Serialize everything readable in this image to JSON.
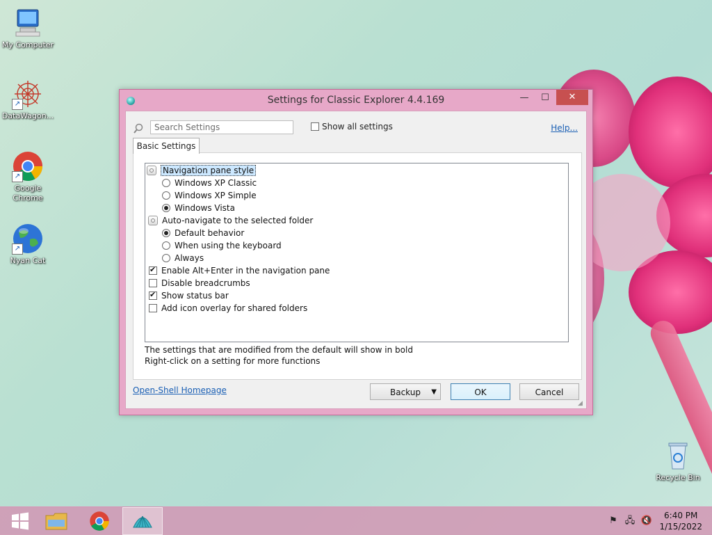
{
  "desktop": {
    "icons": [
      {
        "label": "My Computer",
        "icon": "computer-icon"
      },
      {
        "label": "DataWagon...",
        "icon": "datawagon-icon"
      },
      {
        "label": "Google Chrome",
        "icon": "chrome-icon"
      },
      {
        "label": "Nyan Cat",
        "icon": "globe-icon"
      },
      {
        "label": "Recycle Bin",
        "icon": "recycle-bin-icon"
      }
    ]
  },
  "dialog": {
    "title": "Settings for Classic Explorer 4.4.169",
    "controls": {
      "minimize": "—",
      "maximize": "☐",
      "close": "✕"
    },
    "search": {
      "placeholder": "Search Settings",
      "value": ""
    },
    "show_all": {
      "label": "Show all settings",
      "checked": false
    },
    "help_link": "Help...",
    "tab": "Basic Settings",
    "settings": {
      "nav_group": "Navigation pane style",
      "nav_options": [
        "Windows XP Classic",
        "Windows XP Simple",
        "Windows Vista"
      ],
      "nav_selected": "Windows Vista",
      "auto_group": "Auto-navigate to the selected folder",
      "auto_options": [
        "Default behavior",
        "When using the keyboard",
        "Always"
      ],
      "auto_selected": "Default behavior",
      "checkboxes": [
        {
          "label": "Enable Alt+Enter in the navigation pane",
          "checked": true
        },
        {
          "label": "Disable breadcrumbs",
          "checked": false
        },
        {
          "label": "Show status bar",
          "checked": true
        },
        {
          "label": "Add icon overlay for shared folders",
          "checked": false
        }
      ]
    },
    "notes": [
      "The settings that are modified from the default will show in bold",
      "Right-click on a setting for more functions"
    ],
    "homepage_link": "Open-Shell Homepage",
    "buttons": {
      "backup": "Backup",
      "ok": "OK",
      "cancel": "Cancel"
    }
  },
  "taskbar": {
    "items": [
      "start-icon",
      "file-explorer-icon",
      "chrome-icon",
      "open-shell-icon"
    ],
    "active_item": "open-shell-icon",
    "clock": {
      "time": "6:40 PM",
      "date": "1/15/2022"
    }
  }
}
